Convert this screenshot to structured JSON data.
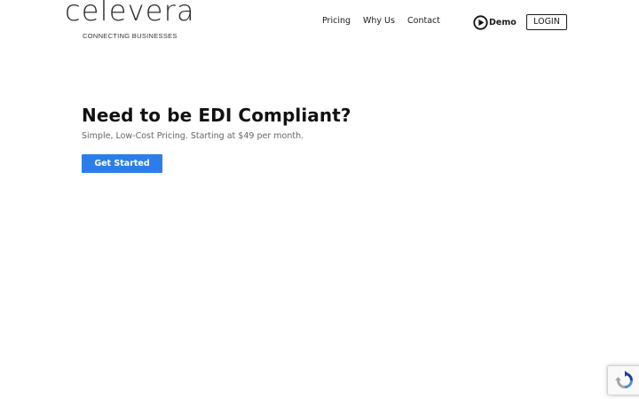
{
  "header": {
    "logo_text": "celevera",
    "tagline": "CONNECTING BUSINESSES",
    "nav": {
      "pricing": "Pricing",
      "why_us": "Why Us",
      "contact": "Contact"
    },
    "demo_label": "Demo",
    "login_label": "LOGIN"
  },
  "hero": {
    "title": "Need to be EDI Compliant?",
    "subtitle": "Simple, Low-Cost Pricing. Starting at $49 per month.",
    "cta_label": "Get Started"
  },
  "colors": {
    "accent": "#2b7de9",
    "text": "#111111",
    "muted": "#666666"
  },
  "icons": {
    "demo": "play-circle-icon",
    "captcha": "recaptcha-icon"
  }
}
